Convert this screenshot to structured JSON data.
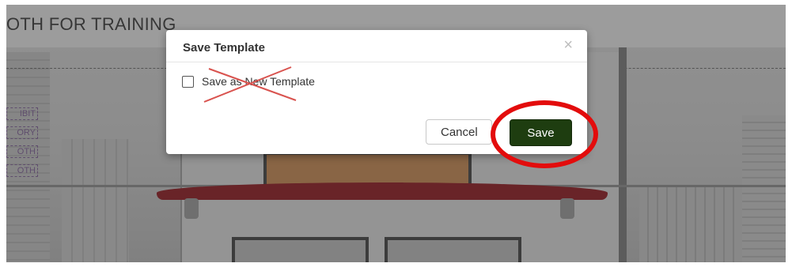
{
  "background": {
    "booth_title": "OTH FOR TRAINING",
    "side_labels": [
      "IBIT",
      "ORY",
      "OTH",
      "OTH"
    ]
  },
  "dialog": {
    "title": "Save Template",
    "close_symbol": "×",
    "checkbox": {
      "label": "Save as New Template",
      "checked": false
    },
    "cancel_label": "Cancel",
    "save_label": "Save"
  },
  "annotations": {
    "highlight_color": "#e30c0c",
    "cross_out_color": "#d9534f"
  },
  "colors": {
    "save_button": "#1e3d10",
    "beam": "#8e1219"
  }
}
